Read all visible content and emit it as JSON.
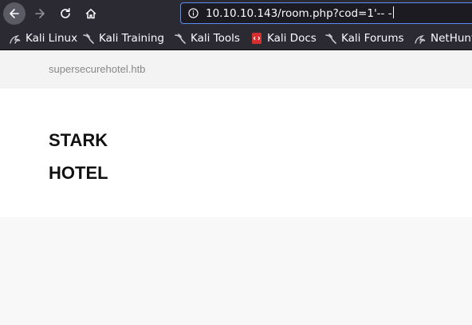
{
  "browser": {
    "url": "10.10.10.143/room.php?cod=1'-- -",
    "bookmarks": [
      {
        "label": "Kali Linux",
        "icon": "kali-dragon-icon"
      },
      {
        "label": "Kali Training",
        "icon": "kali-dragon-icon"
      },
      {
        "label": "Kali Tools",
        "icon": "kali-dragon-icon"
      },
      {
        "label": "Kali Docs",
        "icon": "kali-docs-icon"
      },
      {
        "label": "Kali Forums",
        "icon": "kali-dragon-icon"
      },
      {
        "label": "NetHunter",
        "icon": "nethunter-icon"
      }
    ]
  },
  "page": {
    "site_name": "supersecurehotel.htb",
    "title_line1": "STARK",
    "title_line2": "HOTEL"
  },
  "colors": {
    "toolbar_bg": "#2b2a33",
    "urlbar_focus": "#5a8ef0",
    "docs_icon": "#d32f2f"
  }
}
